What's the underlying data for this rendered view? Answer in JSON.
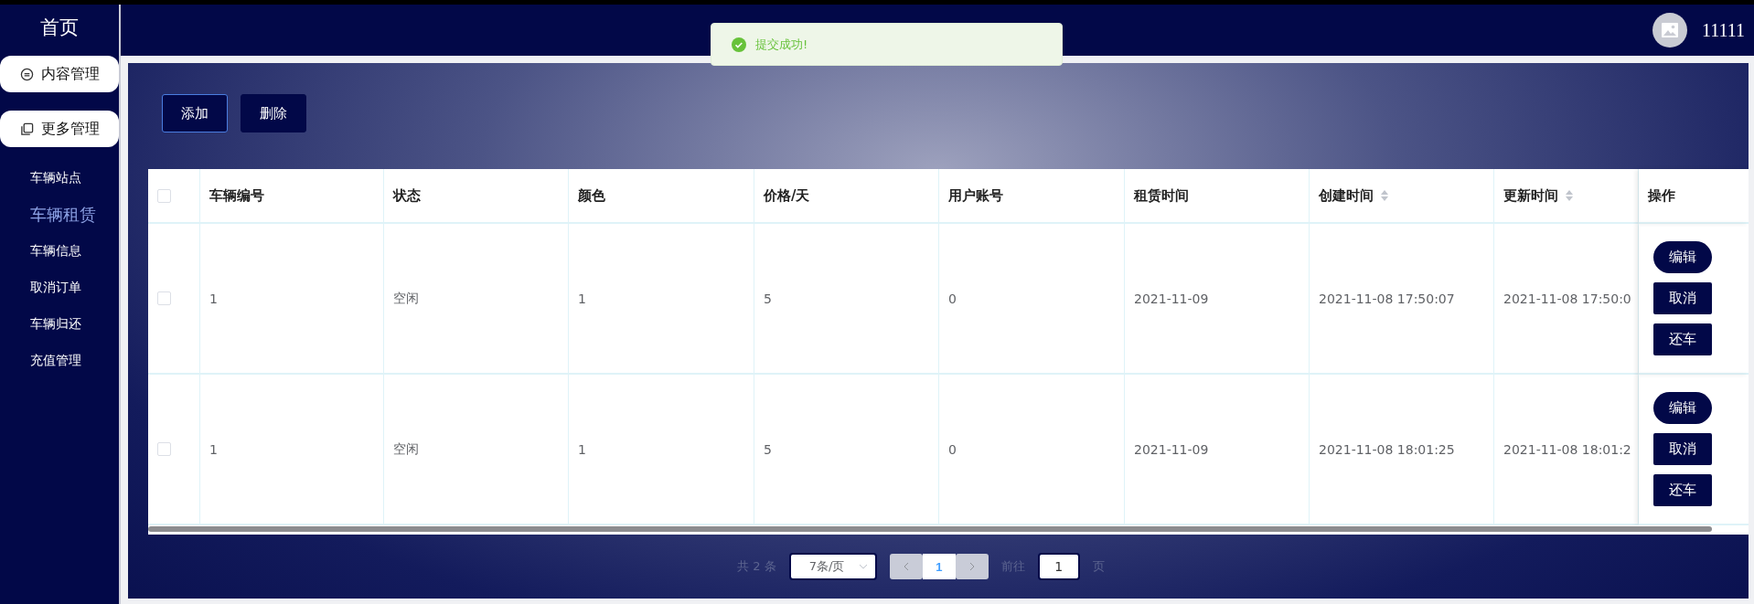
{
  "sidebar": {
    "title": "首页",
    "groups": [
      {
        "label": "内容管理"
      },
      {
        "label": "更多管理"
      }
    ],
    "items": [
      {
        "label": "车辆站点",
        "selected": false
      },
      {
        "label": "车辆租赁",
        "selected": true
      },
      {
        "label": "车辆信息",
        "selected": false
      },
      {
        "label": "取消订单",
        "selected": false
      },
      {
        "label": "车辆归还",
        "selected": false
      },
      {
        "label": "充值管理",
        "selected": false
      }
    ]
  },
  "header": {
    "username": "11111"
  },
  "toast": {
    "message": "提交成功!"
  },
  "toolbar": [
    "添加",
    "删除"
  ],
  "table": {
    "header_checked": false,
    "columns": [
      {
        "label": "车辆编号",
        "sortable": false
      },
      {
        "label": "状态",
        "sortable": false
      },
      {
        "label": "颜色",
        "sortable": false
      },
      {
        "label": "价格/天",
        "sortable": false
      },
      {
        "label": "用户账号",
        "sortable": false
      },
      {
        "label": "租赁时间",
        "sortable": false
      },
      {
        "label": "创建时间",
        "sortable": true
      },
      {
        "label": "更新时间",
        "sortable": true
      }
    ],
    "action_column": "操作",
    "rows": [
      {
        "checked": false,
        "cells": [
          "1",
          "空闲",
          "1",
          "5",
          "0",
          "2021-11-09",
          "2021-11-08 17:50:07",
          "2021-11-08 17:50:0"
        ],
        "actions": [
          {
            "label": "编辑",
            "kind": "pill"
          },
          {
            "label": "取消",
            "kind": "square"
          },
          {
            "label": "还车",
            "kind": "square"
          }
        ]
      },
      {
        "checked": false,
        "cells": [
          "1",
          "空闲",
          "1",
          "5",
          "0",
          "2021-11-09",
          "2021-11-08 18:01:25",
          "2021-11-08 18:01:2"
        ],
        "actions": [
          {
            "label": "编辑",
            "kind": "pill"
          },
          {
            "label": "取消",
            "kind": "square"
          },
          {
            "label": "还车",
            "kind": "square"
          }
        ]
      }
    ]
  },
  "pagination": {
    "total": "共 2 条",
    "page_size": "7条/页",
    "pages": [
      {
        "label": "1",
        "selected": true
      }
    ],
    "goto_label": "前往",
    "goto_value": "1",
    "goto_suffix": "页"
  }
}
